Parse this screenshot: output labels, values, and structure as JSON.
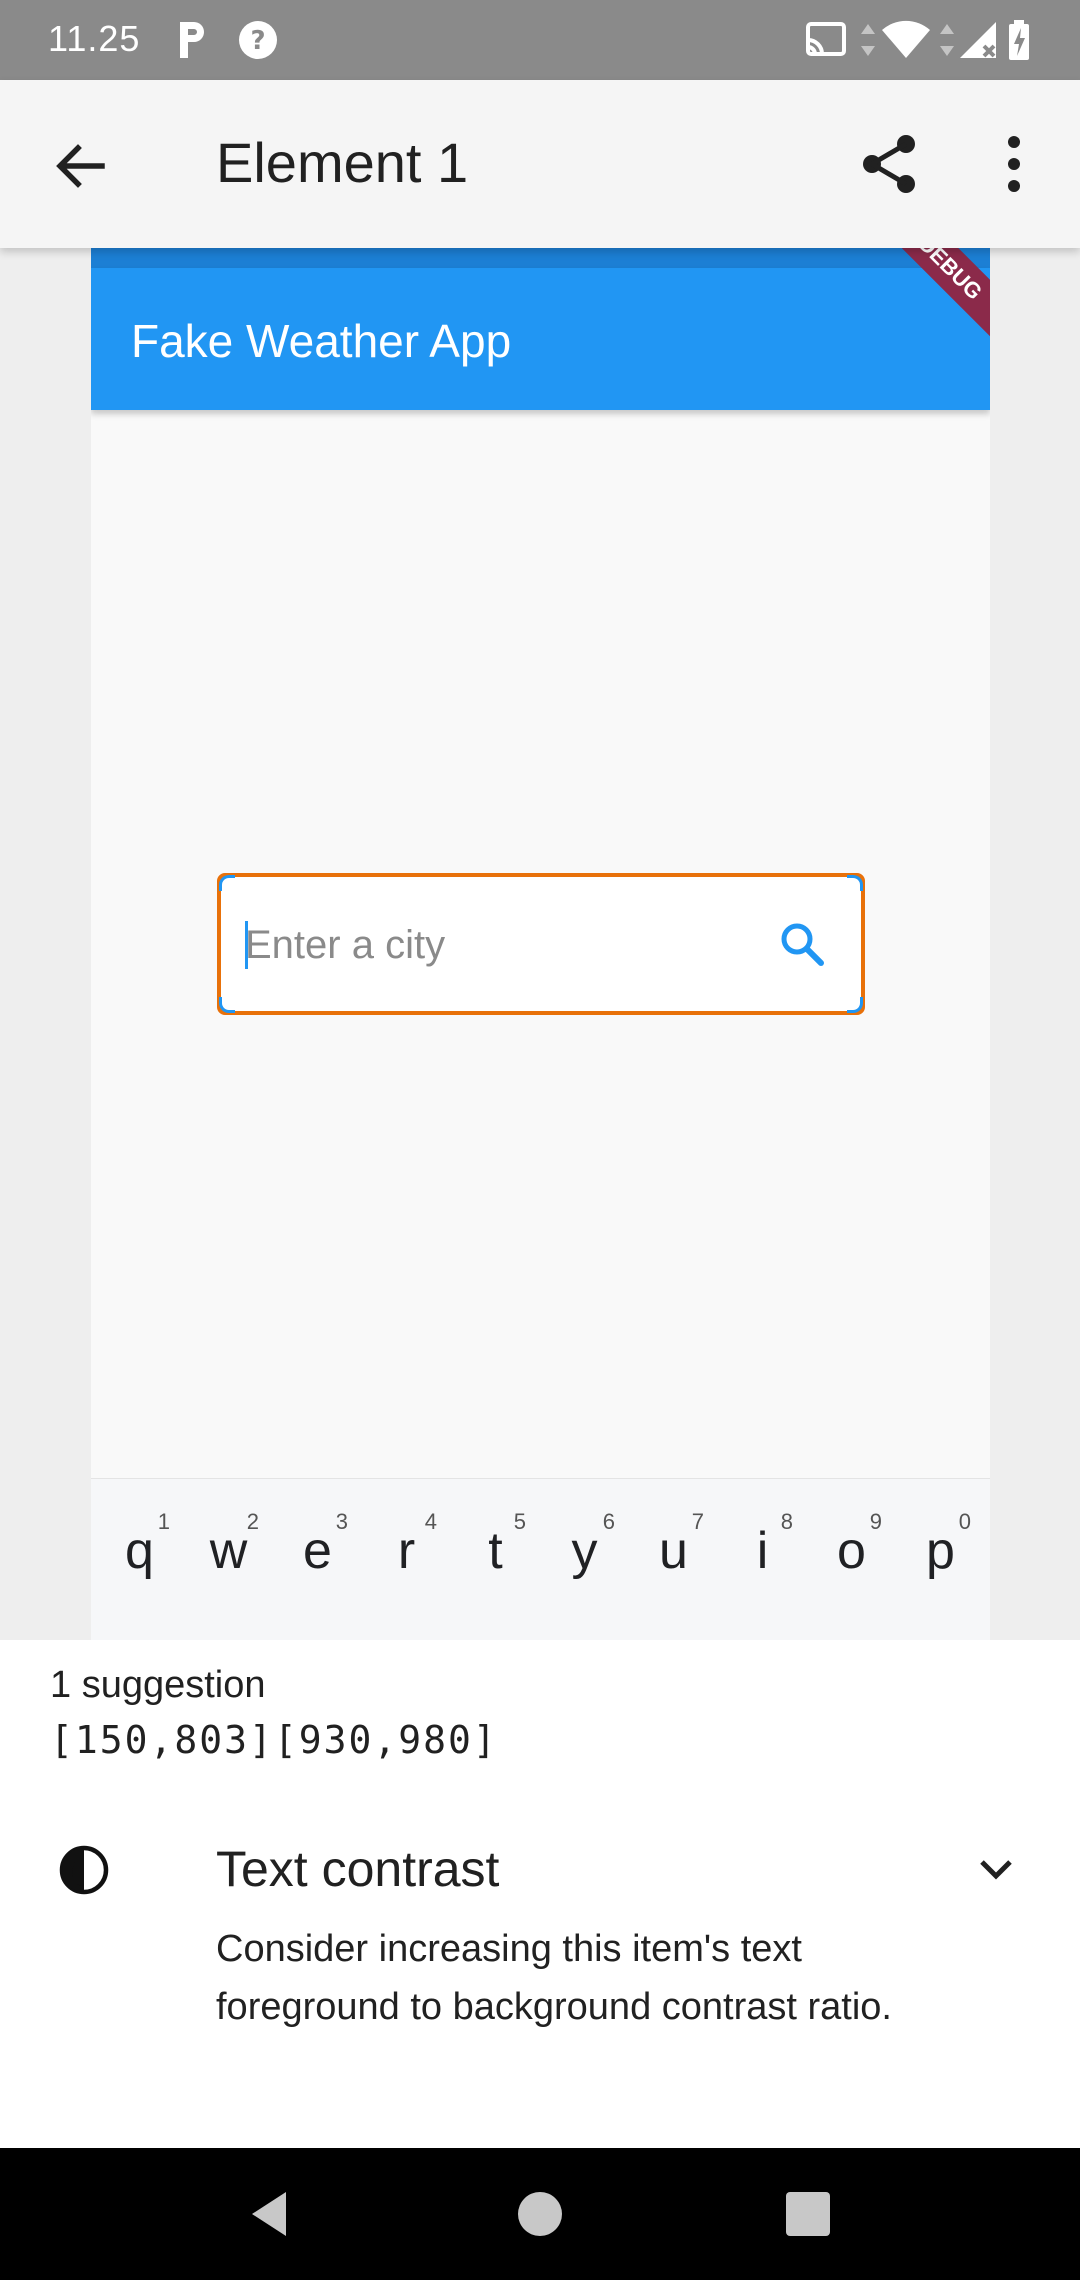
{
  "status_bar": {
    "time": "11.25",
    "icons": [
      "parking-icon",
      "help-icon",
      "cast-icon",
      "data-arrows-icon",
      "wifi-icon",
      "signal-icon",
      "battery-icon"
    ]
  },
  "toolbar": {
    "title": "Element 1",
    "back_icon": "arrow-back-icon",
    "share_icon": "share-icon",
    "more_icon": "more-vert-icon"
  },
  "preview": {
    "app_title": "Fake Weather App",
    "debug_banner": "DEBUG",
    "search": {
      "placeholder": "Enter a city",
      "value": ""
    },
    "keyboard_row": [
      {
        "key": "q",
        "hint": "1"
      },
      {
        "key": "w",
        "hint": "2"
      },
      {
        "key": "e",
        "hint": "3"
      },
      {
        "key": "r",
        "hint": "4"
      },
      {
        "key": "t",
        "hint": "5"
      },
      {
        "key": "y",
        "hint": "6"
      },
      {
        "key": "u",
        "hint": "7"
      },
      {
        "key": "i",
        "hint": "8"
      },
      {
        "key": "o",
        "hint": "9"
      },
      {
        "key": "p",
        "hint": "0"
      }
    ]
  },
  "sheet": {
    "suggestion_count": "1 suggestion",
    "bounds": "[150,803][930,980]",
    "suggestion": {
      "title": "Text contrast",
      "description": "Consider increasing this item's text foreground to background contrast ratio."
    }
  },
  "colors": {
    "app_bar": "#2196f3",
    "highlight": "#e8710a",
    "debug": "#8b2a4a"
  }
}
